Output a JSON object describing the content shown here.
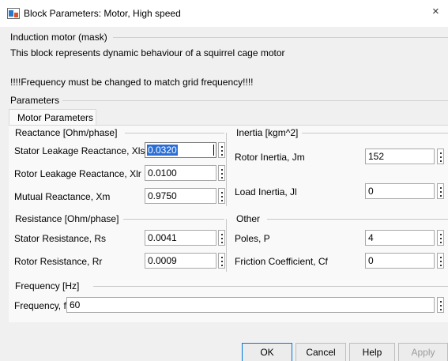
{
  "window": {
    "title": "Block Parameters: Motor, High speed",
    "close_glyph": "×"
  },
  "mask": {
    "type_label": "Induction motor (mask)",
    "description": "This block represents dynamic behaviour of a squirrel cage motor",
    "note": "!!!!Frequency must be changed to match grid frequency!!!!"
  },
  "parameters_label": "Parameters",
  "tab": {
    "label": "Motor Parameters"
  },
  "groups": {
    "reactance": {
      "title": "Reactance [Ohm/phase]",
      "fields": [
        {
          "label": "Stator Leakage Reactance, Xls",
          "value": "0.0320"
        },
        {
          "label": "Rotor Leakage Reactance, Xlr",
          "value": "0.0100"
        },
        {
          "label": "Mutual Reactance, Xm",
          "value": "0.9750"
        }
      ]
    },
    "inertia": {
      "title": "Inertia [kgm^2]",
      "fields": [
        {
          "label": "Rotor Inertia, Jm",
          "value": "152"
        },
        {
          "label": "Load Inertia, Jl",
          "value": "0"
        }
      ]
    },
    "resistance": {
      "title": "Resistance [Ohm/phase]",
      "fields": [
        {
          "label": "Stator Resistance, Rs",
          "value": "0.0041"
        },
        {
          "label": "Rotor Resistance, Rr",
          "value": "0.0009"
        }
      ]
    },
    "other": {
      "title": "Other",
      "fields": [
        {
          "label": "Poles, P",
          "value": "4"
        },
        {
          "label": "Friction Coefficient, Cf",
          "value": "0"
        }
      ]
    },
    "frequency": {
      "title": "Frequency [Hz]",
      "fields": [
        {
          "label": "Frequency, f",
          "value": "60"
        }
      ]
    }
  },
  "buttons": {
    "ok": "OK",
    "cancel": "Cancel",
    "help": "Help",
    "apply": "Apply"
  },
  "colors": {
    "selection": "#2b6fd6",
    "focus_border": "#0078d7",
    "disabled_text": "#9c9c9c"
  }
}
